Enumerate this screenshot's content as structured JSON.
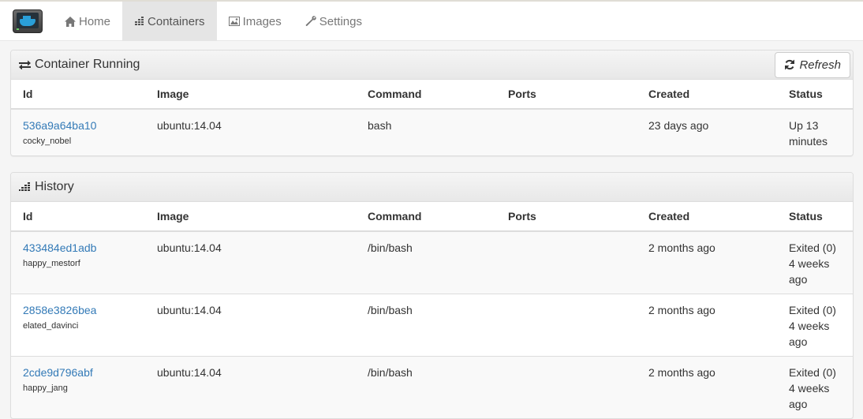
{
  "navbar": {
    "logo": "docker-ui-logo",
    "items": [
      {
        "label": "Home",
        "icon": "home-icon",
        "active": false
      },
      {
        "label": "Containers",
        "icon": "tasks-icon",
        "active": true
      },
      {
        "label": "Images",
        "icon": "picture-icon",
        "active": false
      },
      {
        "label": "Settings",
        "icon": "wrench-icon",
        "active": false
      }
    ]
  },
  "running": {
    "title": "Container Running",
    "icon": "transfer-icon",
    "refresh_label": "Refresh",
    "refresh_icon": "refresh-icon",
    "columns": [
      "Id",
      "Image",
      "Command",
      "Ports",
      "Created",
      "Status"
    ],
    "rows": [
      {
        "id": "536a9a64ba10",
        "name": "cocky_nobel",
        "image": "ubuntu:14.04",
        "command": "bash",
        "ports": "",
        "created": "23 days ago",
        "status": "Up 13 minutes"
      }
    ]
  },
  "history": {
    "title": "History",
    "icon": "tasks-icon",
    "columns": [
      "Id",
      "Image",
      "Command",
      "Ports",
      "Created",
      "Status"
    ],
    "rows": [
      {
        "id": "433484ed1adb",
        "name": "happy_mestorf",
        "image": "ubuntu:14.04",
        "command": "/bin/bash",
        "ports": "",
        "created": "2 months ago",
        "status": "Exited (0) 4 weeks ago"
      },
      {
        "id": "2858e3826bea",
        "name": "elated_davinci",
        "image": "ubuntu:14.04",
        "command": "/bin/bash",
        "ports": "",
        "created": "2 months ago",
        "status": "Exited (0) 4 weeks ago"
      },
      {
        "id": "2cde9d796abf",
        "name": "happy_jang",
        "image": "ubuntu:14.04",
        "command": "/bin/bash",
        "ports": "",
        "created": "2 months ago",
        "status": "Exited (0) 4 weeks ago"
      }
    ]
  },
  "colors": {
    "link": "#337ab7",
    "nav_active_bg": "#e5e5e5",
    "page_bg": "#f5f5f5"
  }
}
